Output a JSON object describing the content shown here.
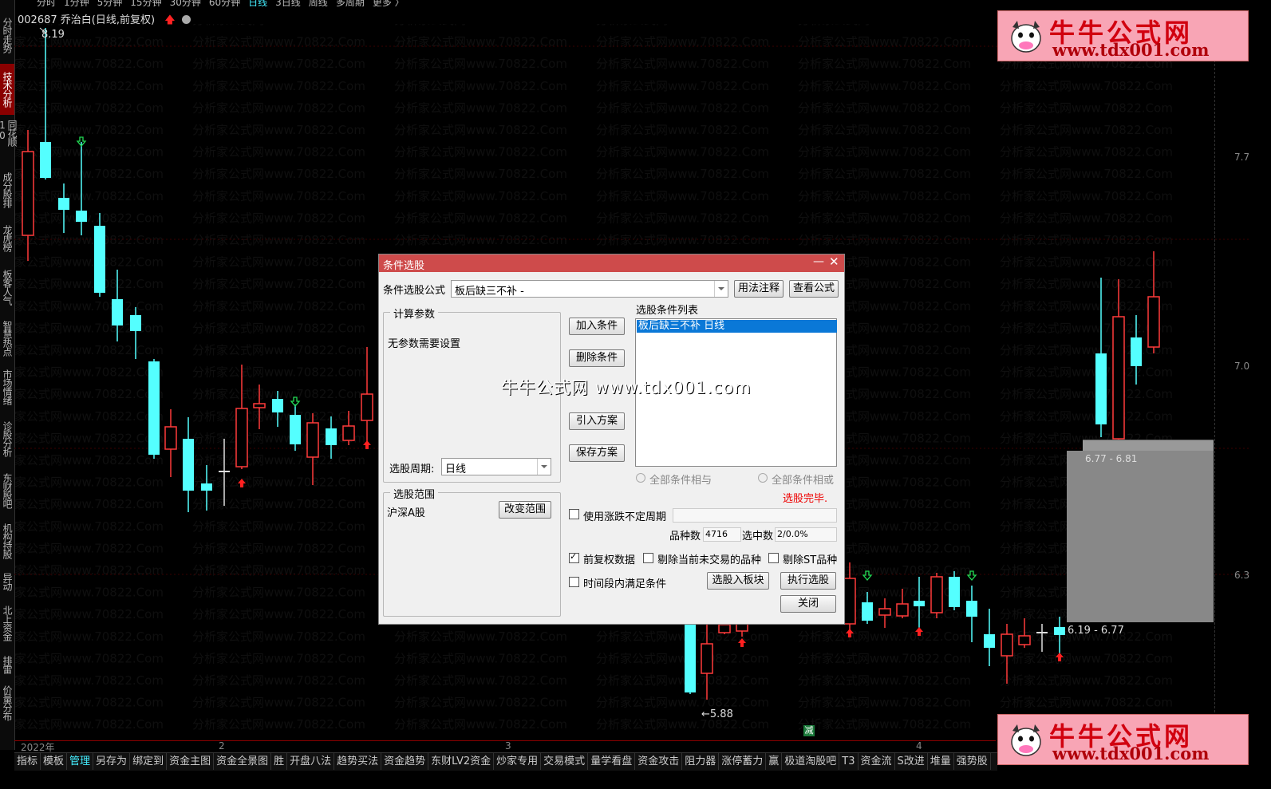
{
  "top_periods": [
    "分时",
    "1分钟",
    "5分钟",
    "15分钟",
    "30分钟",
    "60分钟",
    "日线",
    "3日线",
    "周线",
    "多周期",
    "更多 〉"
  ],
  "active_period": "日线",
  "left_tabs": [
    {
      "label": "分时走势"
    },
    {
      "label": "技术分析",
      "active": true
    },
    {
      "label": "同花顺10"
    },
    {
      "label": "成分股排"
    },
    {
      "label": "龙虎榜"
    },
    {
      "label": "板客人气"
    },
    {
      "label": "智慧热点"
    },
    {
      "label": "市场情绪"
    },
    {
      "label": "诊股分析"
    },
    {
      "label": "东财股吧"
    },
    {
      "label": "机构持股"
    },
    {
      "label": "异动"
    },
    {
      "label": "北上资金"
    },
    {
      "label": "排雷"
    },
    {
      "label": "价量分布"
    }
  ],
  "stock": {
    "code": "002687",
    "name": "乔治白(日线,前复权)"
  },
  "price_labels": {
    "high": "8.19",
    "low": "5.88",
    "range_top": "6.77 - 6.81",
    "range_bottom": "6.19 - 6.77"
  },
  "right_axis": [
    "7.7",
    "7.0",
    "6.3"
  ],
  "time_axis": [
    "2022年",
    "2",
    "3",
    "4"
  ],
  "reduce_badge": "减",
  "bottom_tabs": [
    "指标",
    "模板",
    "管理",
    "另存为",
    "绑定到",
    "资金主图",
    "资金全景图",
    "胜",
    "开盘八法",
    "趋势买法",
    "资金趋势",
    "东财LV2资金",
    "炒家专用",
    "交易模式",
    "量学看盘",
    "资金攻击",
    "阻力器",
    "涨停蓄力",
    "赢",
    "极道淘股吧",
    "T3",
    "资金流",
    "S改进",
    "堆量",
    "强势股"
  ],
  "active_bottom_tab": "管理",
  "logo": {
    "title": "牛牛公式网",
    "url": "www.tdx001.com"
  },
  "watermark": {
    "text": "分析家公式网www.70822.Com"
  },
  "center_watermark": "牛牛公式网 www.tdx001.com",
  "dialog": {
    "title": "条件选股",
    "formula_label": "条件选股公式",
    "formula_value": "板后缺三不补 -",
    "usage_btn": "用法注释",
    "view_btn": "查看公式",
    "calc_params_title": "计算参数",
    "no_params": "无参数需要设置",
    "period_label": "选股周期:",
    "period_value": "日线",
    "scope_title": "选股范围",
    "scope_value": "沪深A股",
    "change_scope_btn": "改变范围",
    "add_cond_btn": "加入条件",
    "del_cond_btn": "删除条件",
    "import_btn": "引入方案",
    "save_btn": "保存方案",
    "cond_list_title": "选股条件列表",
    "cond_items": [
      "板后缺三不补   日线"
    ],
    "radio_and": "全部条件相与",
    "radio_or": "全部条件相或",
    "status": "选股完毕.",
    "use_uneven": "使用涨跌不定周期",
    "count_label": "品种数",
    "count_value": "4716",
    "selected_label": "选中数",
    "selected_value": "2/0.0%",
    "adj_data": "前复权数据",
    "exclude_untraded": "剔除当前未交易的品种",
    "exclude_st": "剔除ST品种",
    "period_within": "时间段内满足条件",
    "to_board_btn": "选股入板块",
    "execute_btn": "执行选股",
    "close_btn": "关闭"
  },
  "colors": {
    "up": "#ff3b3b",
    "down": "#54ffff",
    "dialog_title": "#ce4b4b",
    "selected": "#0a78d7"
  }
}
